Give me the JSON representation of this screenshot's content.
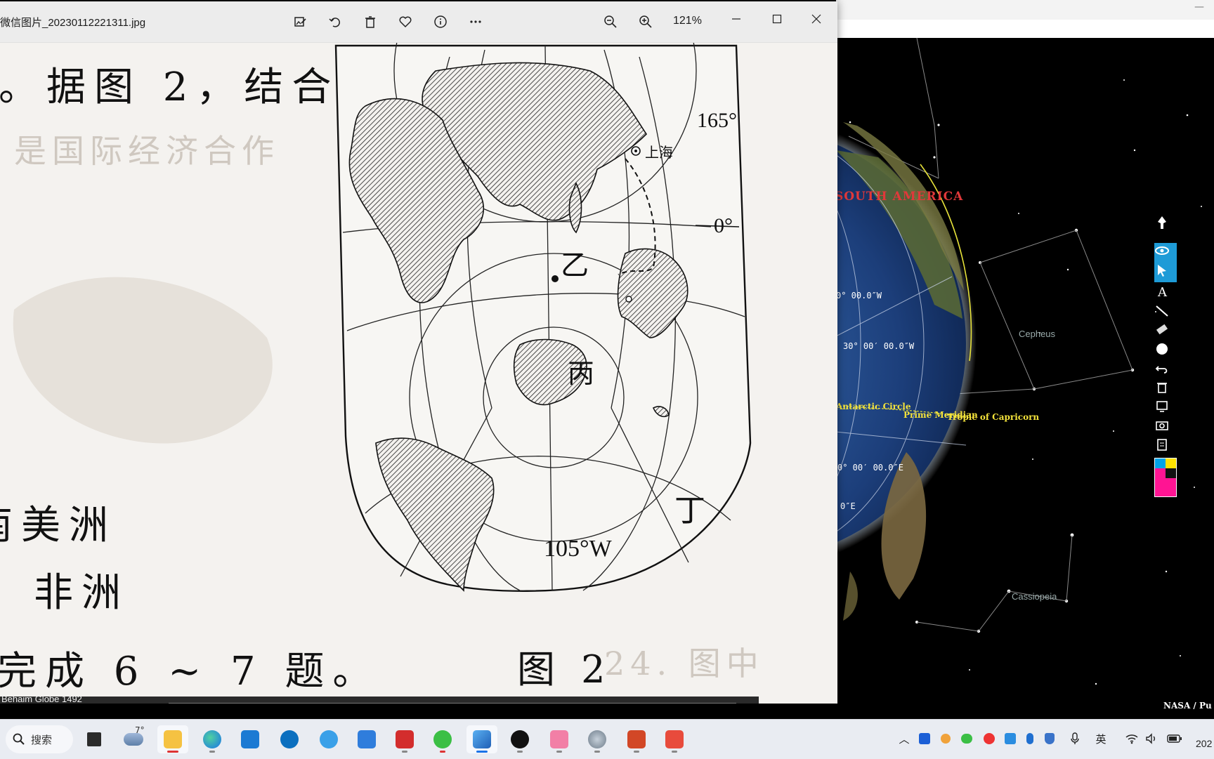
{
  "viewer": {
    "title": "微信图片_20230112221311.jpg",
    "zoom": "121%",
    "toolbar_icons": [
      "edit-image-icon",
      "rotate-icon",
      "delete-icon",
      "favorite-icon",
      "info-icon",
      "more-icon"
    ],
    "zoom_icons": [
      "zoom-out-icon",
      "zoom-in-icon"
    ]
  },
  "photo": {
    "question_lines": [
      "。据图 2，结合",
      "南美洲",
      "、非洲",
      "完成 6 ~ 7 题。"
    ],
    "ghost_text": [
      "是国际经济合作",
      "24. 图中"
    ],
    "figure_caption": "图 2",
    "map_labels": {
      "shanghai": "上海",
      "lon_165": "165°",
      "equator": "0°",
      "yi": "乙",
      "bing": "丙",
      "ding": "丁",
      "lon_105w": "105°W"
    }
  },
  "background_app": {
    "continent_label": "SOUTH AMERICA",
    "coord_labels": [
      "0° 00.0″W",
      "30° 00′ 00.0″W",
      "0° 00′ 00.0″E",
      "0″E"
    ],
    "circle_labels": [
      "Antarctic Circle",
      "Prime Meridian",
      "Tropic of Capricorn"
    ],
    "constellations": [
      "Cepheus",
      "Cassiopeia"
    ],
    "credit": "NASA / Pu",
    "filmstrip_text": "Behaim Globe 1492",
    "palette_colors": [
      "#1e9bd7",
      "#fde100",
      "#00a3e8",
      "#111111",
      "#ff1493"
    ]
  },
  "taskbar": {
    "search_label": "搜索",
    "weather_temp": "7°",
    "ime_label": "英",
    "clock": "202"
  }
}
